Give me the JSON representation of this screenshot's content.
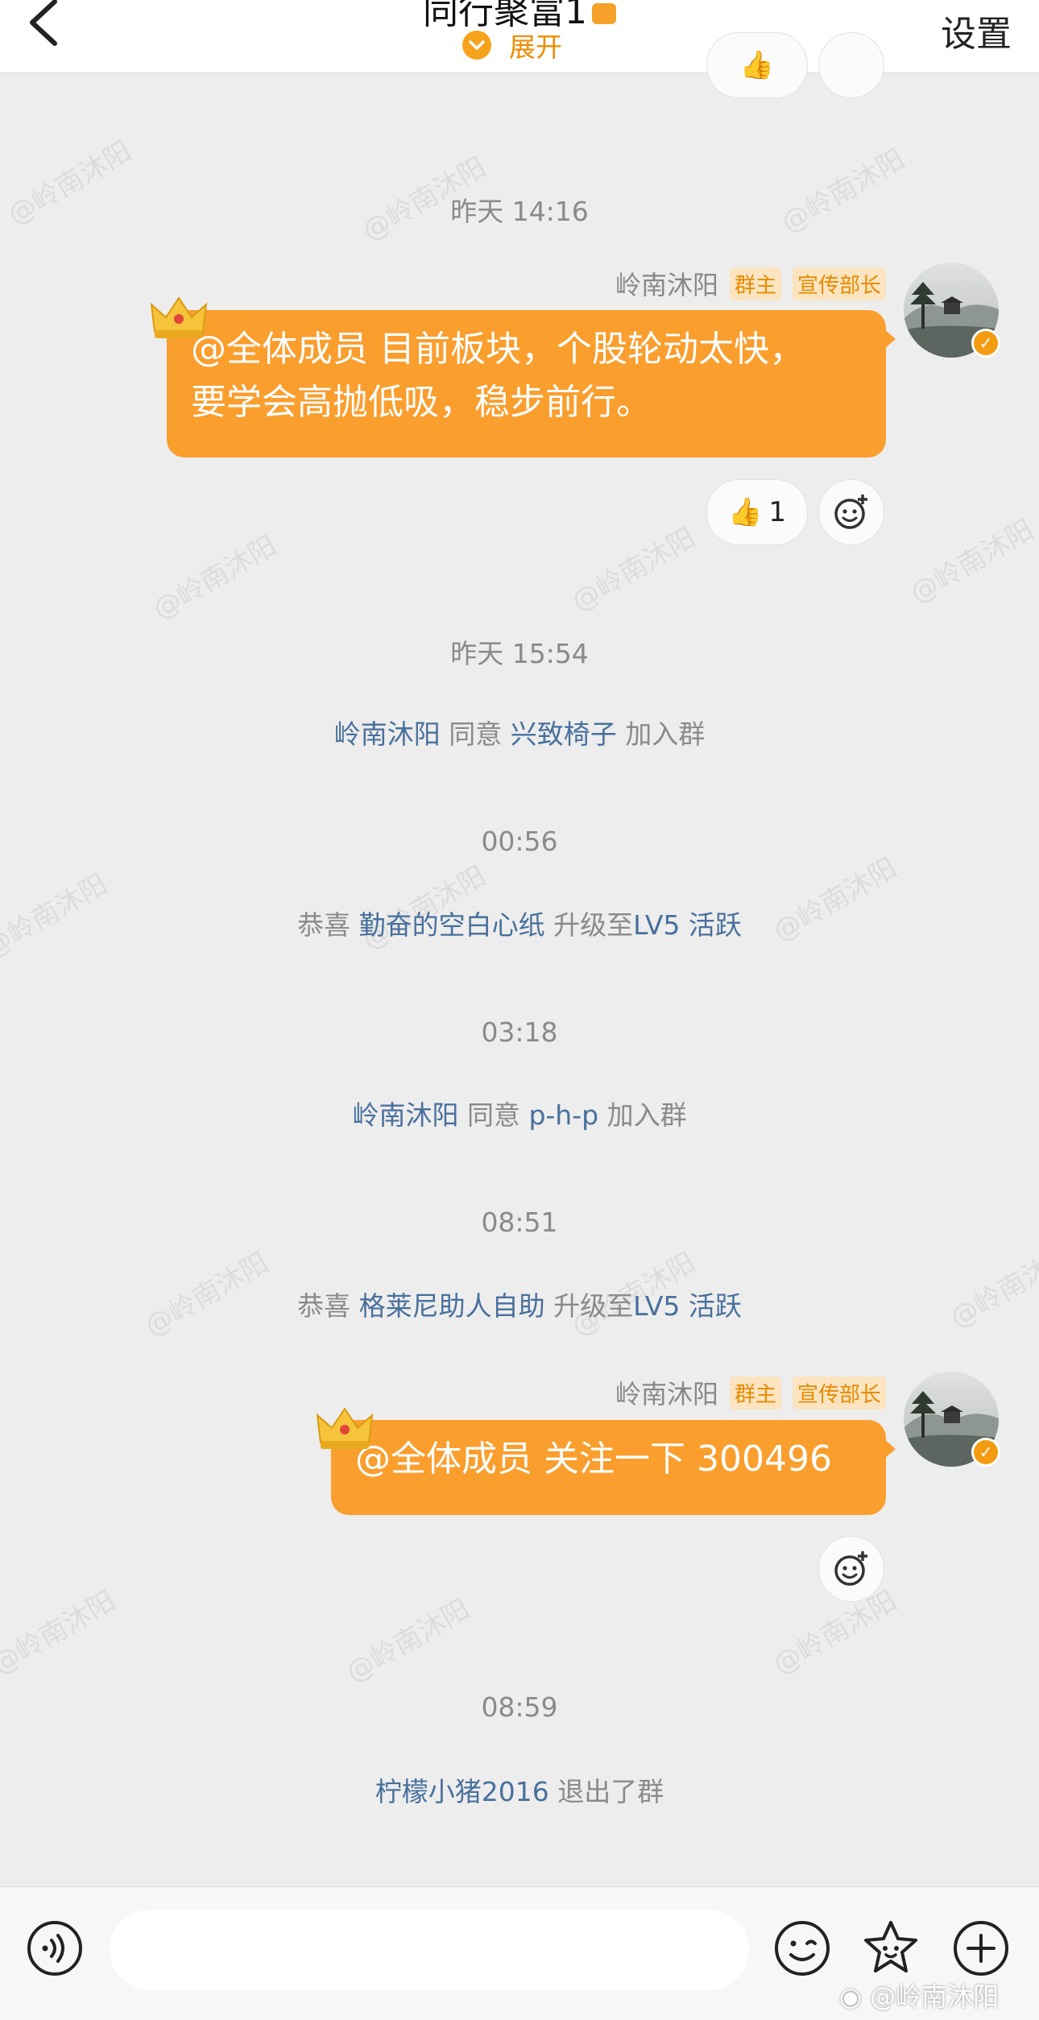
{
  "header": {
    "title": "同行聚富1",
    "expand_label": "展开",
    "settings_label": "设置"
  },
  "watermark_text": "@岭南沐阳",
  "messages": {
    "msg1": {
      "time": "昨天 14:16",
      "sender": "岭南沐阳",
      "badge_owner": "群主",
      "badge_title": "宣传部长",
      "line1": "@全体成员 目前板块，个股轮动太快，",
      "line2": "要学会高抛低吸，稳步前行。",
      "thumbs_count": "1"
    },
    "sys1": {
      "time": "昨天 15:54",
      "actor": "岭南沐阳",
      "verb": "同意",
      "target": "兴致椅子",
      "suffix": "加入群"
    },
    "sys2": {
      "time": "00:56",
      "prefix": "恭喜",
      "target": "勤奋的空白心纸",
      "verb": "升级至",
      "level": "LV5 活跃"
    },
    "sys3": {
      "time": "03:18",
      "actor": "岭南沐阳",
      "verb": "同意",
      "target": "p-h-p",
      "suffix": "加入群"
    },
    "sys4": {
      "time": "08:51",
      "prefix": "恭喜",
      "target": "格莱尼助人自助",
      "verb": "升级至",
      "level": "LV5 活跃"
    },
    "msg2": {
      "sender": "岭南沐阳",
      "badge_owner": "群主",
      "badge_title": "宣传部长",
      "text": "@全体成员 关注一下 300496"
    },
    "sys5": {
      "time": "08:59",
      "target": "柠檬小猪2016",
      "suffix": "退出了群"
    }
  },
  "colors": {
    "accent": "#fa9e2e",
    "link": "#48709c",
    "badge_text": "#e88a00",
    "badge_bg": "#fbe4bf"
  },
  "bottom_bar": {
    "icons": [
      "voice-icon",
      "emoji-icon",
      "sticker-icon",
      "plus-icon"
    ]
  },
  "weibo_watermark": "@岭南沐阳"
}
